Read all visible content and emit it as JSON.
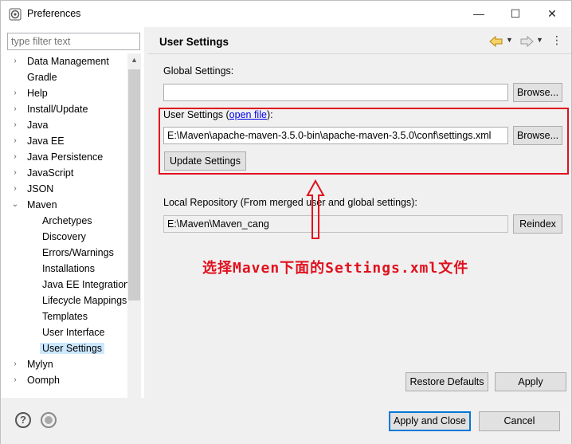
{
  "window": {
    "title": "Preferences",
    "minimize_glyph": "—",
    "maximize_glyph": "☐",
    "close_glyph": "✕"
  },
  "filter": {
    "placeholder": "type filter text"
  },
  "tree": {
    "items": [
      {
        "label": "Data Management",
        "twisty": "›"
      },
      {
        "label": "Gradle",
        "twisty": ""
      },
      {
        "label": "Help",
        "twisty": "›"
      },
      {
        "label": "Install/Update",
        "twisty": "›"
      },
      {
        "label": "Java",
        "twisty": "›"
      },
      {
        "label": "Java EE",
        "twisty": "›"
      },
      {
        "label": "Java Persistence",
        "twisty": "›"
      },
      {
        "label": "JavaScript",
        "twisty": "›"
      },
      {
        "label": "JSON",
        "twisty": "›"
      },
      {
        "label": "Maven",
        "twisty": "⌄"
      },
      {
        "label": "Archetypes"
      },
      {
        "label": "Discovery"
      },
      {
        "label": "Errors/Warnings"
      },
      {
        "label": "Installations"
      },
      {
        "label": "Java EE Integration"
      },
      {
        "label": "Lifecycle Mappings"
      },
      {
        "label": "Templates"
      },
      {
        "label": "User Interface"
      },
      {
        "label": "User Settings"
      },
      {
        "label": "Mylyn",
        "twisty": "›"
      },
      {
        "label": "Oomph",
        "twisty": "›"
      }
    ]
  },
  "page": {
    "title": "User Settings",
    "global_settings_label": "Global Settings:",
    "global_settings_value": "",
    "browse_label": "Browse...",
    "user_settings_label": "User Settings (",
    "open_file_link": "open file",
    "user_settings_suffix": "):",
    "user_settings_value": "E:\\Maven\\apache-maven-3.5.0-bin\\apache-maven-3.5.0\\conf\\settings.xml",
    "update_settings_label": "Update Settings",
    "local_repo_label": "Local Repository (From merged user and global settings):",
    "local_repo_value": "E:\\Maven\\Maven_cang",
    "reindex_label": "Reindex",
    "restore_defaults_label": "Restore Defaults",
    "apply_label": "Apply"
  },
  "annotation": {
    "text": "选择Maven下面的Settings.xml文件",
    "color": "#e1111e"
  },
  "footer": {
    "apply_close_label": "Apply and Close",
    "cancel_label": "Cancel"
  },
  "colors": {
    "accent": "#0078d7",
    "selection": "#cce8ff",
    "annotation": "#e1111e"
  }
}
